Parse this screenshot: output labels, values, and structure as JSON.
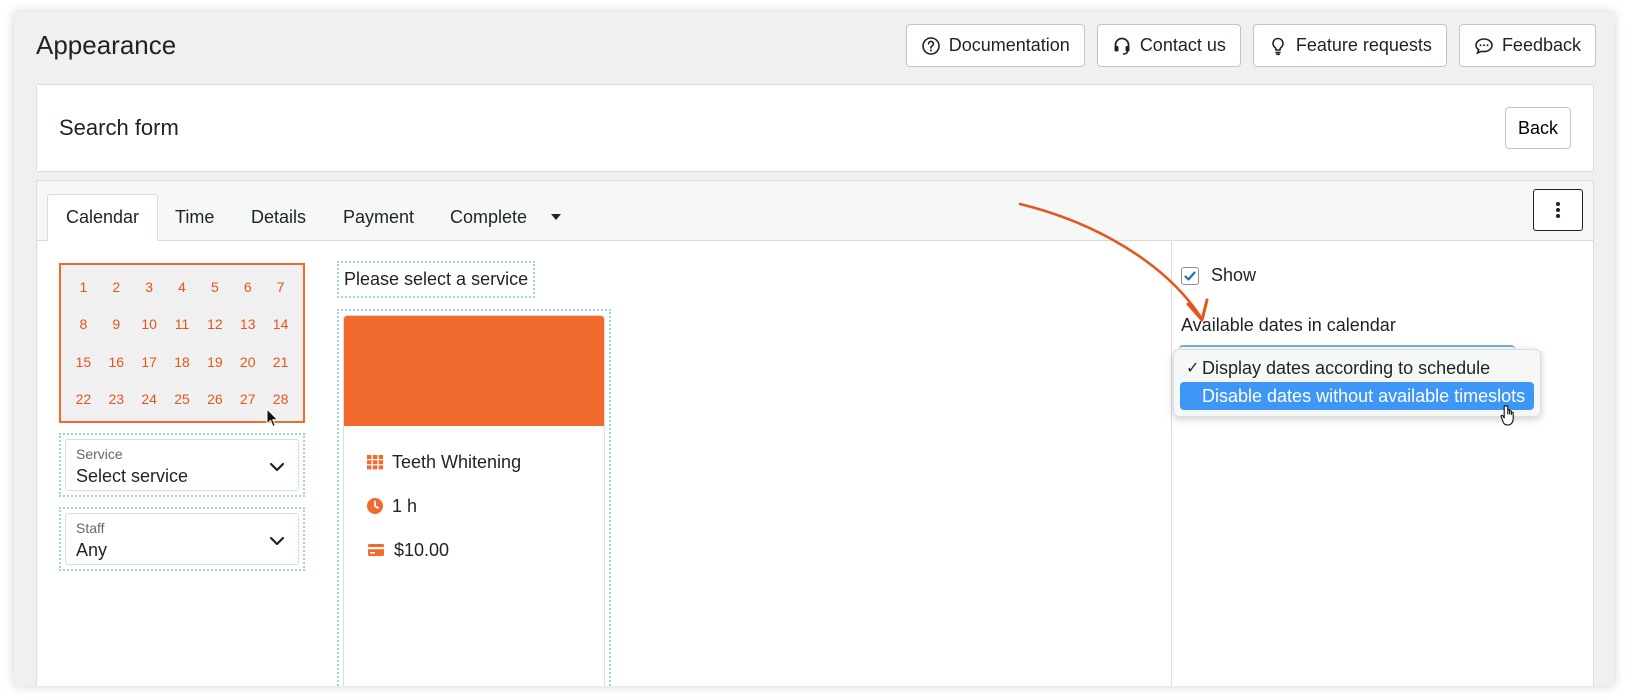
{
  "page": {
    "title": "Appearance"
  },
  "top_buttons": [
    {
      "label": "Documentation",
      "icon": "question-circle-icon"
    },
    {
      "label": "Contact us",
      "icon": "headset-icon"
    },
    {
      "label": "Feature requests",
      "icon": "lightbulb-icon"
    },
    {
      "label": "Feedback",
      "icon": "chat-bubble-icon"
    }
  ],
  "header_panel": {
    "title": "Search form",
    "back_label": "Back"
  },
  "tabs": [
    {
      "label": "Calendar",
      "active": true
    },
    {
      "label": "Time"
    },
    {
      "label": "Details"
    },
    {
      "label": "Payment"
    },
    {
      "label": "Complete"
    }
  ],
  "calendar": {
    "days": [
      "1",
      "2",
      "3",
      "4",
      "5",
      "6",
      "7",
      "8",
      "9",
      "10",
      "11",
      "12",
      "13",
      "14",
      "15",
      "16",
      "17",
      "18",
      "19",
      "20",
      "21",
      "22",
      "23",
      "24",
      "25",
      "26",
      "27",
      "28"
    ],
    "accent": "#f26b2e"
  },
  "service_select": {
    "label": "Service",
    "value": "Select service"
  },
  "staff_select": {
    "label": "Staff",
    "value": "Any"
  },
  "service_prompt": "Please select a service",
  "service_card": {
    "name": "Teeth Whitening",
    "duration": "1 h",
    "price": "$10.00",
    "banner_color": "#f26b2e"
  },
  "settings": {
    "show_label": "Show",
    "show_checked": true,
    "available_dates_label": "Available dates in calendar",
    "options": [
      {
        "label": "Display dates according to schedule",
        "selected": true
      },
      {
        "label": "Disable dates without available timeslots",
        "highlighted": true
      }
    ]
  },
  "colors": {
    "highlight": "#3e97f7",
    "orange": "#f26b2e",
    "dotted_border": "#9ed3ea"
  }
}
